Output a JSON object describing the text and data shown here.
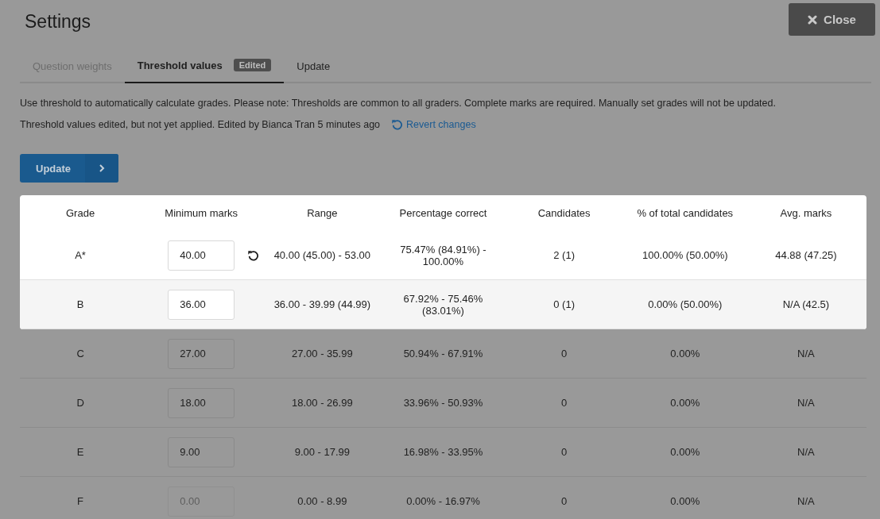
{
  "dialog": {
    "title": "Settings",
    "close_button": {
      "label": "Close"
    }
  },
  "tabs": [
    {
      "label": "Question weights",
      "selected": false,
      "disabled": true
    },
    {
      "label": "Threshold values",
      "selected": true,
      "disabled": false,
      "badge": "Edited"
    },
    {
      "label": "Update",
      "selected": false,
      "disabled": false
    }
  ],
  "description": "Use threshold to automatically calculate grades. Please note: Thresholds are common to all graders. Complete marks are required. Manually set grades will not be updated.",
  "edit_notice": {
    "text": "Threshold values edited, but not yet applied. Edited by Bianca Tran 5 minutes ago",
    "link": "Revert changes"
  },
  "update_button": {
    "label": "Update"
  },
  "table": {
    "columns": [
      "Grade",
      "Minimum marks",
      "Range",
      "Percentage correct",
      "Candidates",
      "% of total candidates",
      "Avg. marks"
    ],
    "rows": [
      {
        "grade": "A*",
        "minimum_marks": "40.00",
        "edited": true,
        "disabled": false,
        "highlighted": true,
        "range": "40.00 (45.00) - 53.00",
        "percentage": "75.47% (84.91%) - 100.00%",
        "candidates": "2 (1)",
        "share": "100.00% (50.00%)",
        "avg": "44.88 (47.25)"
      },
      {
        "grade": "B",
        "minimum_marks": "36.00",
        "edited": false,
        "disabled": false,
        "highlighted": true,
        "range": "36.00 - 39.99 (44.99)",
        "percentage": "67.92% - 75.46% (83.01%)",
        "candidates": "0 (1)",
        "share": "0.00% (50.00%)",
        "avg": "N/A (42.5)"
      },
      {
        "grade": "C",
        "minimum_marks": "27.00",
        "edited": false,
        "disabled": false,
        "highlighted": false,
        "range": "27.00 - 35.99",
        "percentage": "50.94% - 67.91%",
        "candidates": "0",
        "share": "0.00%",
        "avg": "N/A"
      },
      {
        "grade": "D",
        "minimum_marks": "18.00",
        "edited": false,
        "disabled": false,
        "highlighted": false,
        "range": "18.00 - 26.99",
        "percentage": "33.96% - 50.93%",
        "candidates": "0",
        "share": "0.00%",
        "avg": "N/A"
      },
      {
        "grade": "E",
        "minimum_marks": "9.00",
        "edited": false,
        "disabled": false,
        "highlighted": false,
        "range": "9.00 - 17.99",
        "percentage": "16.98% - 33.95%",
        "candidates": "0",
        "share": "0.00%",
        "avg": "N/A"
      },
      {
        "grade": "F",
        "minimum_marks": "0.00",
        "edited": false,
        "disabled": true,
        "highlighted": false,
        "range": "0.00 - 8.99",
        "percentage": "0.00% - 16.97%",
        "candidates": "0",
        "share": "0.00%",
        "avg": "N/A"
      }
    ]
  }
}
